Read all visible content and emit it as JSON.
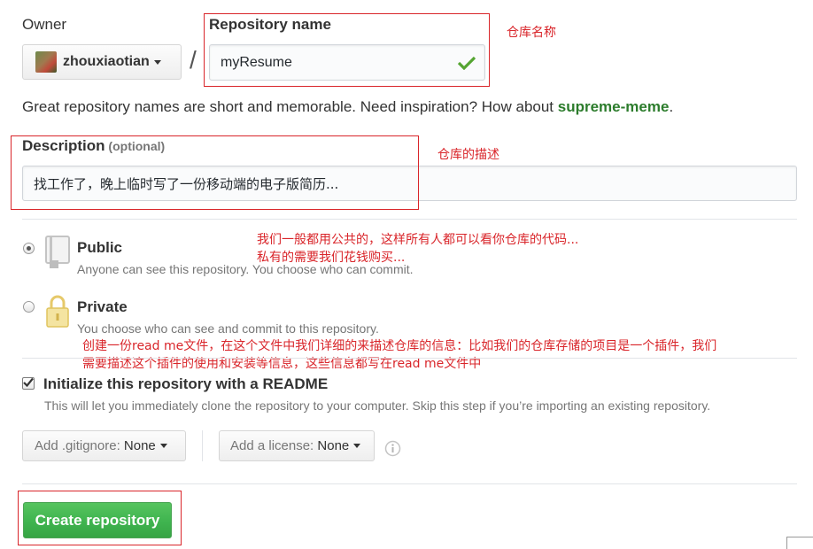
{
  "owner": {
    "label": "Owner",
    "username": "zhouxiaotian"
  },
  "separator": "/",
  "repo_name": {
    "label": "Repository name",
    "value": "myResume"
  },
  "hint": {
    "text": "Great repository names are short and memorable. Need inspiration? How about ",
    "suggestion": "supreme-meme",
    "end": "."
  },
  "description": {
    "label": "Description",
    "optional": "(optional)",
    "value": "找工作了，晚上临时写了一份移动端的电子版简历..."
  },
  "visibility": {
    "public": {
      "title": "Public",
      "desc": "Anyone can see this repository. You choose who can commit.",
      "checked": true
    },
    "private": {
      "title": "Private",
      "desc": "You choose who can see and commit to this repository.",
      "checked": false
    }
  },
  "readme": {
    "label": "Initialize this repository with a README",
    "desc": "This will let you immediately clone the repository to your computer. Skip this step if you’re importing an existing repository.",
    "checked": true
  },
  "gitignore": {
    "prefix": "Add .gitignore:",
    "value": "None"
  },
  "license": {
    "prefix": "Add a license:",
    "value": "None"
  },
  "create_button": "Create repository",
  "annotations": {
    "repo_name": "仓库名称",
    "description": "仓库的描述",
    "public_line1": "我们一般都用公共的，这样所有人都可以看你仓库的代码...",
    "public_line2": "私有的需要我们花钱购买...",
    "readme_line1": "创建一份read me文件，在这个文件中我们详细的来描述仓库的信息：比如我们的仓库存储的项目是一个插件，我们",
    "readme_line2": "需要描述这个插件的使用和安装等信息，这些信息都写在read me文件中"
  },
  "colors": {
    "annotation_red": "#d9252a",
    "suggestion_green": "#2c7c2c",
    "check_green": "#55a532",
    "create_button_green": "#3fb44f"
  }
}
